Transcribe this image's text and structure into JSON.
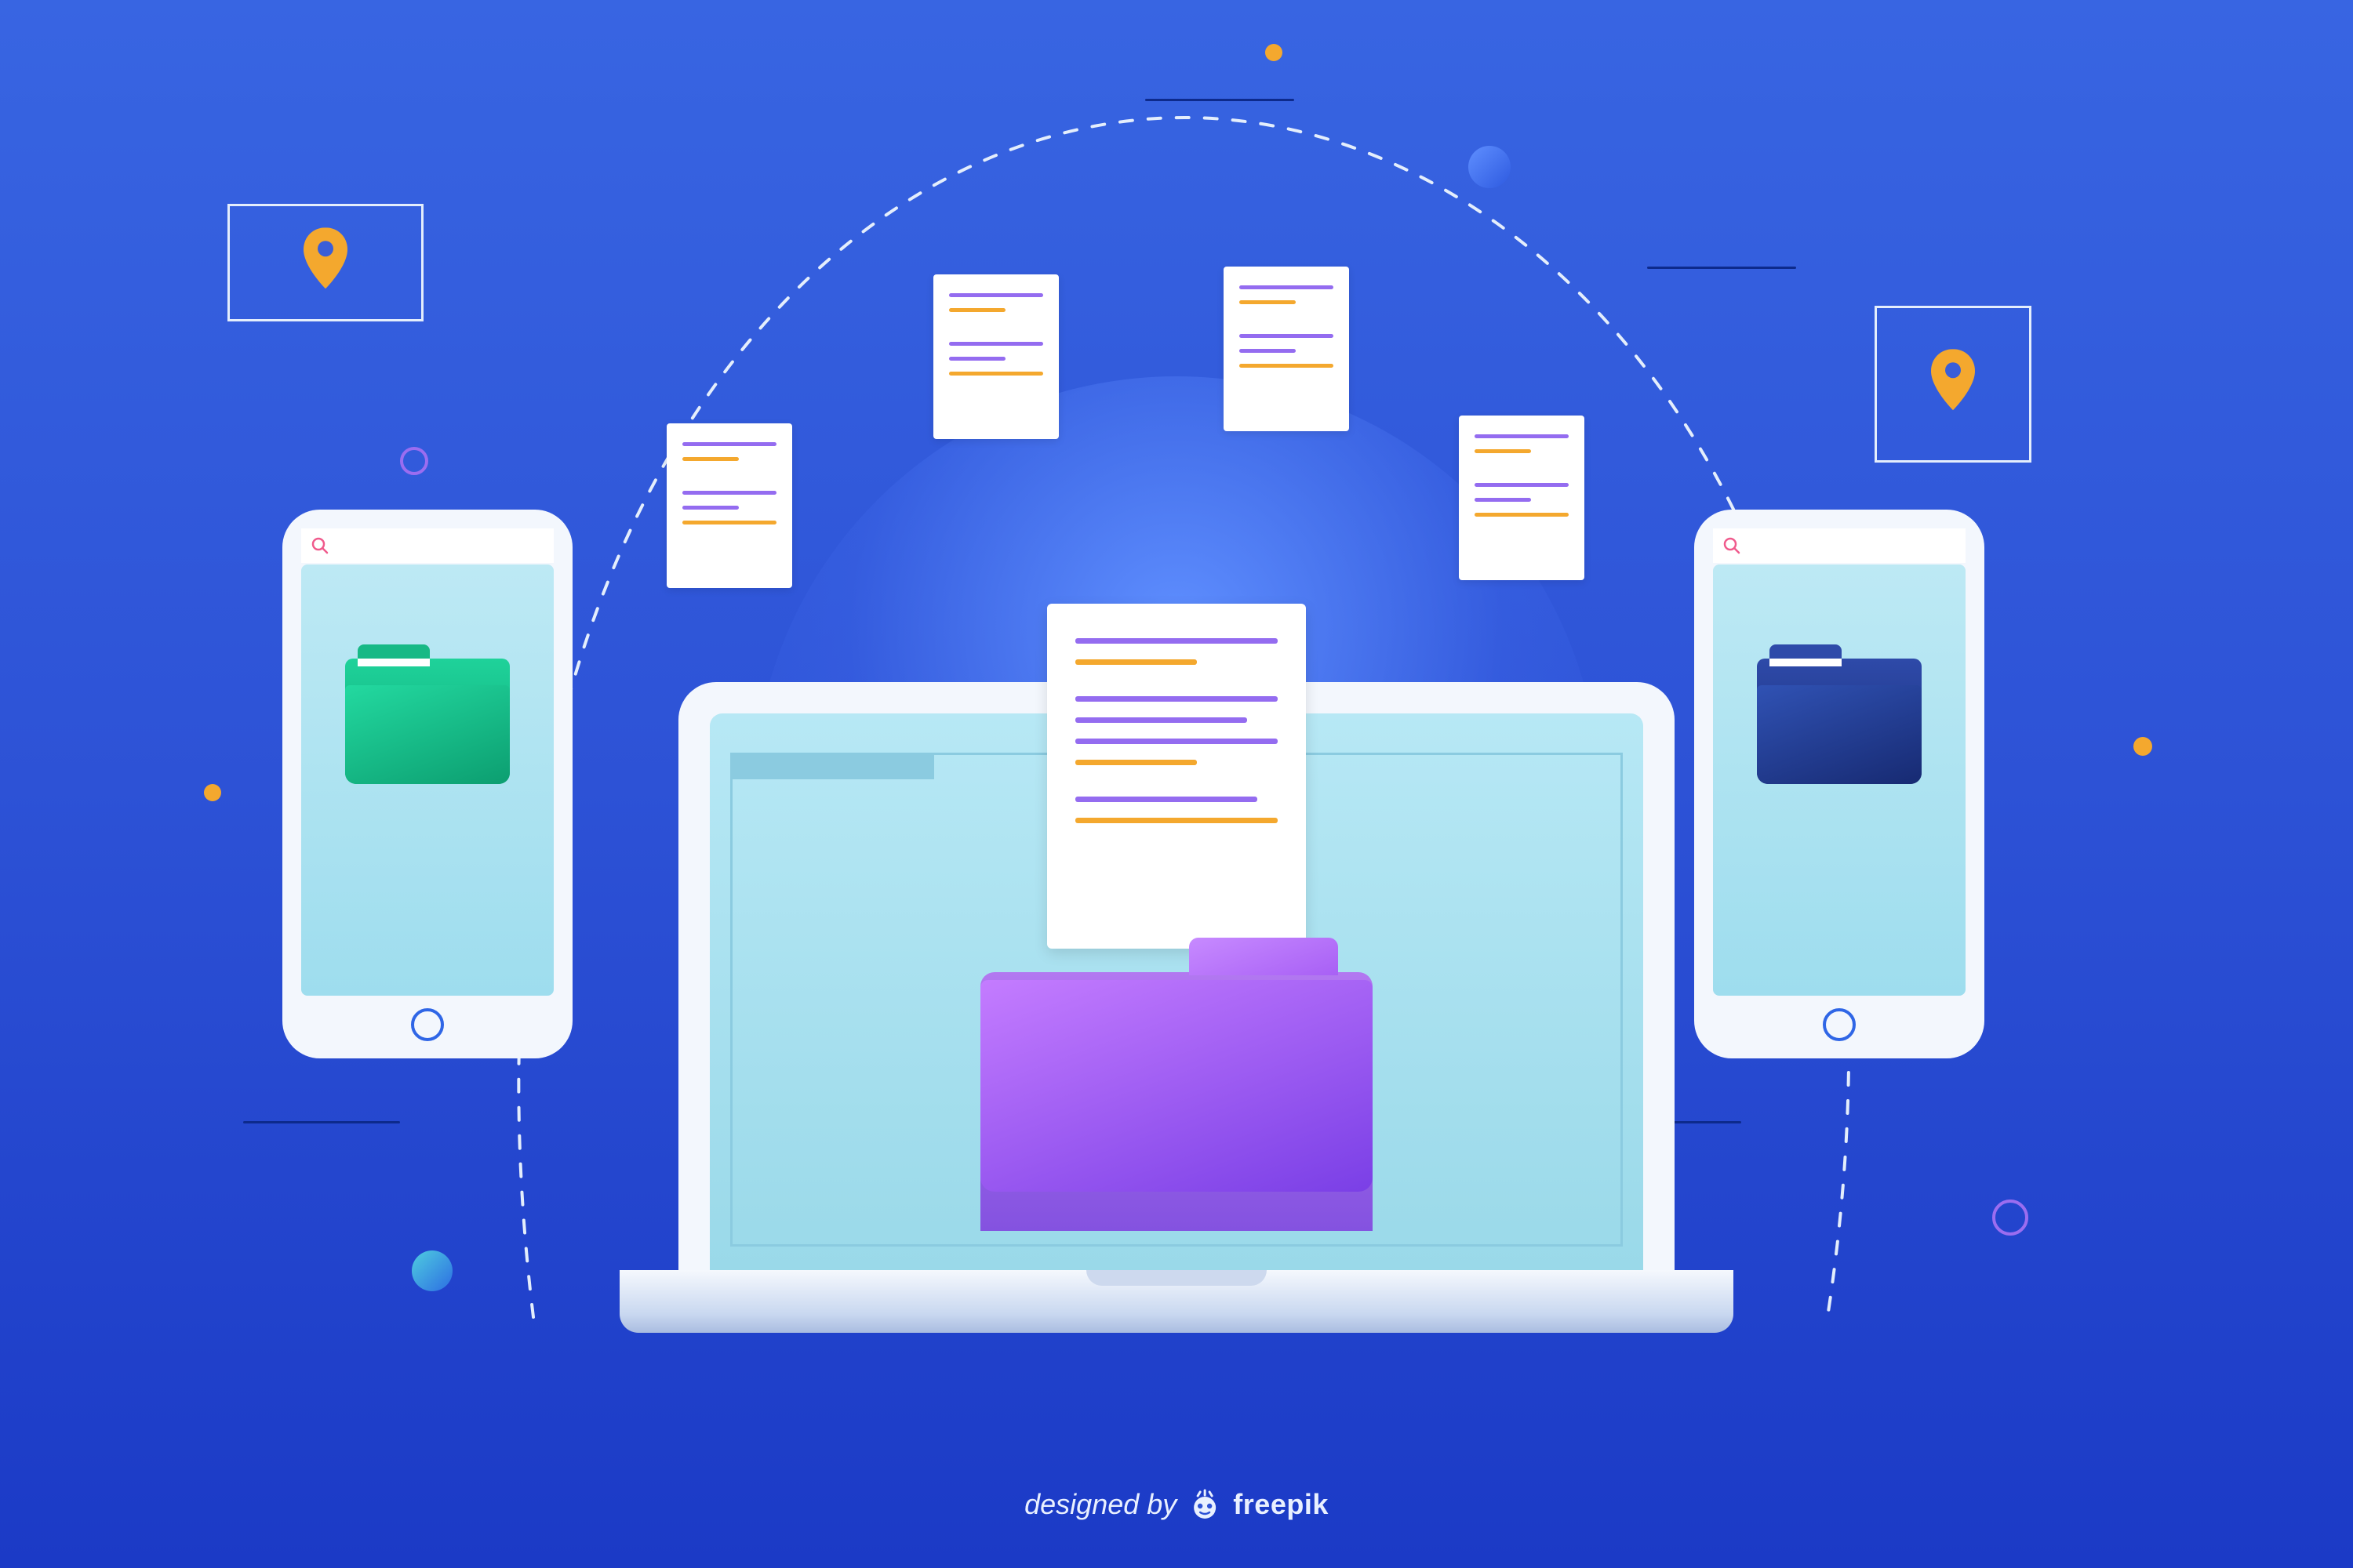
{
  "attribution": {
    "prefix": "designed by",
    "brand": "freepik"
  },
  "colors": {
    "accent_orange": "#f4a82e",
    "accent_purple": "#946cf0",
    "folder_green_a": "#1fcf99",
    "folder_green_b": "#0da877",
    "folder_navy_a": "#2e4aa9",
    "folder_navy_b": "#1b2e78",
    "pin": "#f4a82e"
  }
}
